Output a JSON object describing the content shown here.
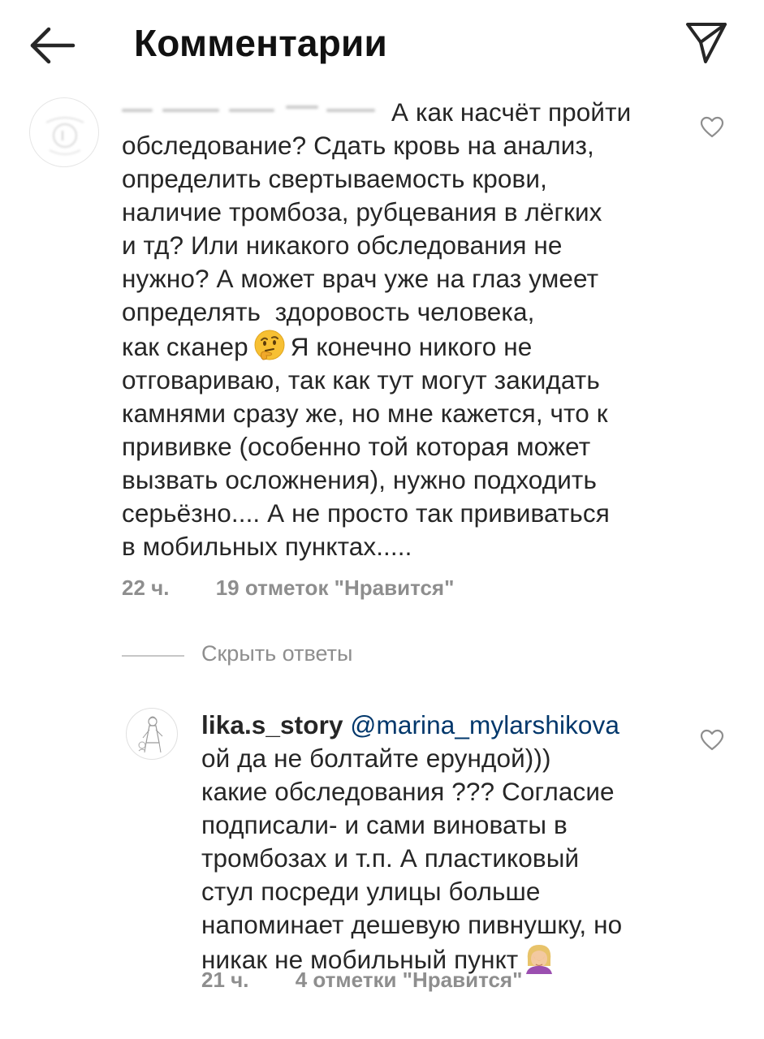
{
  "header": {
    "title": "Комментарии",
    "back_icon": "arrow-left-icon",
    "share_icon": "paper-plane-icon"
  },
  "comments": [
    {
      "username_blurred": true,
      "text_lines": [
        "А как насчёт пройти",
        "обследование? Сдать кровь на анализ,",
        "определить свертываемость крови,",
        "наличие тромбоза, рубцевания в лёгких",
        "и тд? Или никакого обследования не",
        "нужно? А может врач уже на глаз умеет",
        "определять  здоровость человека,",
        "как сканер",
        "Я конечно никого не",
        "отговариваю, так как тут могут закидать",
        "камнями сразу же, но мне кажется, что к",
        "прививке (особенно той которая может",
        "вызвать осложнения), нужно подходить",
        "серьёзно.... А не просто так прививаться",
        "в мобильных пунктах....."
      ],
      "emoji": "thinking-face",
      "time": "22 ч.",
      "likes": "19 отметок \"Нравится\""
    }
  ],
  "hide_replies_label": "Скрыть ответы",
  "replies": [
    {
      "username": "lika.s_story",
      "mention": "@marina_mylarshikova",
      "text_lines": [
        "ой да не болтайте ерундой)))",
        "какие обследования ??? Согласие",
        "подписали- и сами виноваты в",
        "тромбозах и т.п. А пластиковый",
        "стул посреди улицы больше",
        "напоминает дешевую пивнушку, но",
        "никак не мобильный пункт"
      ],
      "emoji": "woman-facepalming",
      "time": "21 ч.",
      "likes": "4 отметки \"Нравится\""
    }
  ],
  "colors": {
    "text": "#262626",
    "meta": "#8e8e8e",
    "mention": "#00376b",
    "divider": "#c7c7c7"
  }
}
